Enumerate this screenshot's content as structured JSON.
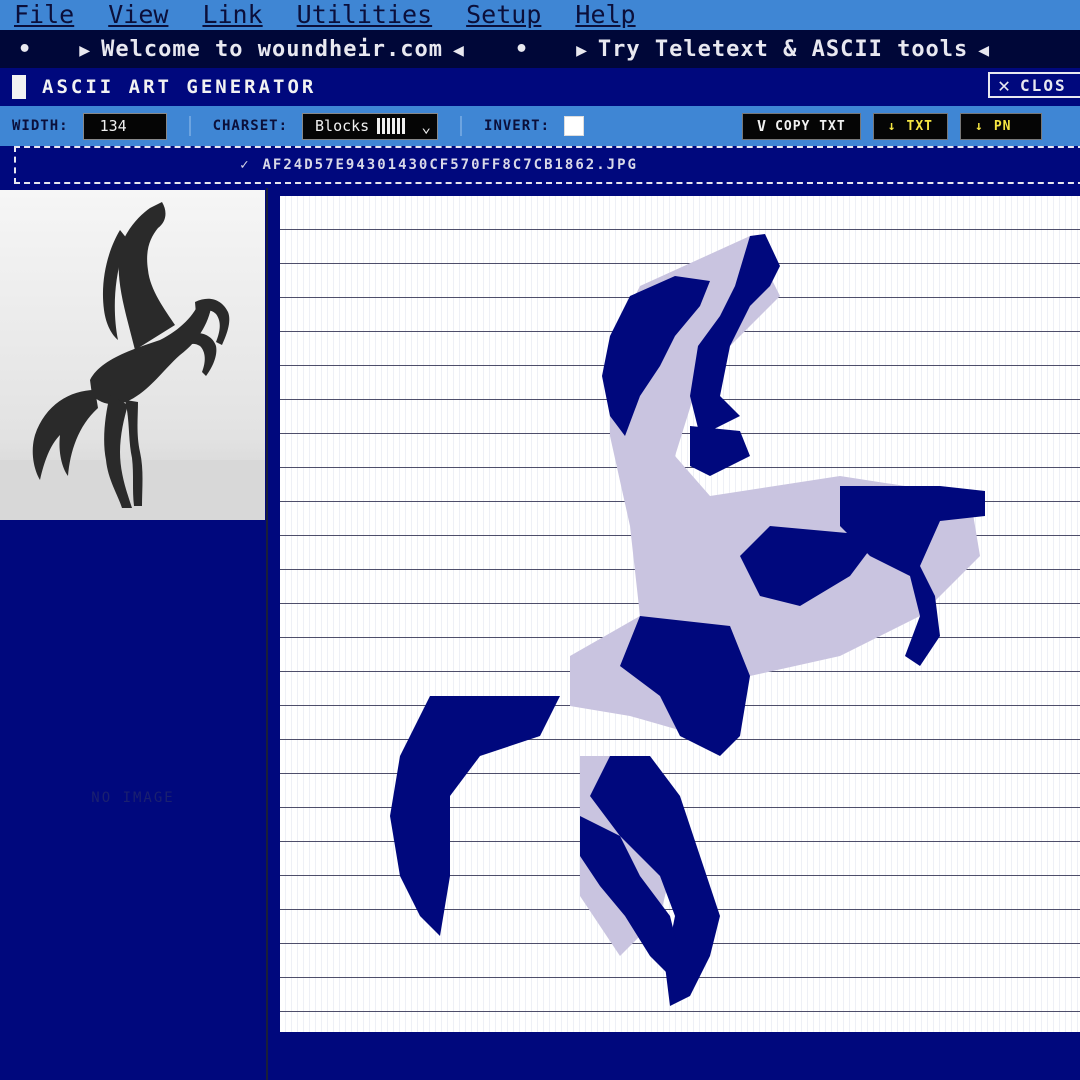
{
  "menu": [
    "File",
    "View",
    "Link",
    "Utilities",
    "Setup",
    "Help"
  ],
  "ticker": {
    "items": [
      "Welcome to woundheir.com",
      "Try Teletext & ASCII tools"
    ]
  },
  "window": {
    "title": "ASCII ART GENERATOR",
    "close_label": "CLOS"
  },
  "toolbar": {
    "width_label": "WIDTH:",
    "width_value": "134",
    "charset_label": "CHARSET:",
    "charset_value": "Blocks",
    "invert_label": "INVERT:",
    "invert_checked": false,
    "copy_label": "COPY TXT",
    "txt_label": "TXT",
    "png_label": "PN"
  },
  "file": {
    "name": "AF24D57E94301430CF570FF8C7CB1862.JPG"
  },
  "left": {
    "empty_label": "NO IMAGE"
  },
  "colors": {
    "ink": "#00087d",
    "shade": "#c9c4e0",
    "paper": "#ffffff",
    "toolbar": "#3f86d4"
  }
}
